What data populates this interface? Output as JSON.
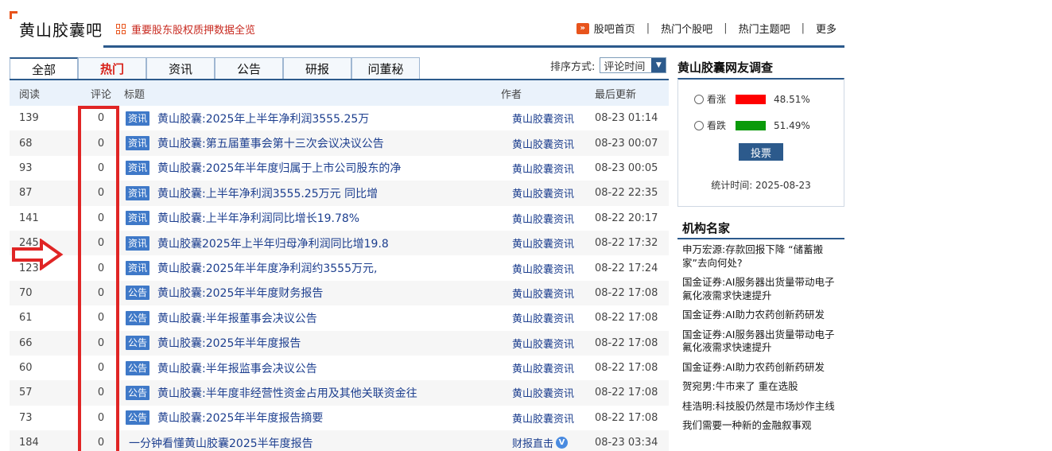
{
  "header": {
    "bar_name": "黄山胶囊吧",
    "pledge_link": "重要股东股权质押数据全览",
    "nav": [
      "股吧首页",
      "热门个股吧",
      "热门主题吧",
      "更多"
    ],
    "nav_sep": "|"
  },
  "tabs": [
    "全部",
    "热门",
    "资讯",
    "公告",
    "研报",
    "问董秘"
  ],
  "sort": {
    "label": "排序方式:",
    "value": "评论时间"
  },
  "list": {
    "columns": [
      "阅读",
      "评论",
      "标题",
      "作者",
      "最后更新"
    ],
    "rows": [
      {
        "read": "139",
        "comments": "0",
        "tag": "资讯",
        "title": "黄山胶囊:2025年上半年净利润3555.25万",
        "author": "黄山胶囊资讯",
        "time": "08-23 01:14"
      },
      {
        "read": "68",
        "comments": "0",
        "tag": "资讯",
        "title": "黄山胶囊:第五届董事会第十三次会议决议公告",
        "author": "黄山胶囊资讯",
        "time": "08-23 00:07"
      },
      {
        "read": "93",
        "comments": "0",
        "tag": "资讯",
        "title": "黄山胶囊:2025年半年度归属于上市公司股东的净",
        "author": "黄山胶囊资讯",
        "time": "08-23 00:05"
      },
      {
        "read": "87",
        "comments": "0",
        "tag": "资讯",
        "title": "黄山胶囊:上半年净利润3555.25万元 同比增",
        "author": "黄山胶囊资讯",
        "time": "08-22 22:35"
      },
      {
        "read": "141",
        "comments": "0",
        "tag": "资讯",
        "title": "黄山胶囊:上半年净利润同比增长19.78%",
        "author": "黄山胶囊资讯",
        "time": "08-22 20:17"
      },
      {
        "read": "245",
        "comments": "0",
        "tag": "资讯",
        "title": "黄山胶囊2025年上半年归母净利润同比增19.8",
        "author": "黄山胶囊资讯",
        "time": "08-22 17:32"
      },
      {
        "read": "123",
        "comments": "0",
        "tag": "资讯",
        "title": "黄山胶囊:2025年半年度净利润约3555万元,",
        "author": "黄山胶囊资讯",
        "time": "08-22 17:24"
      },
      {
        "read": "70",
        "comments": "0",
        "tag": "公告",
        "title": "黄山胶囊:2025年半年度财务报告",
        "author": "黄山胶囊资讯",
        "time": "08-22 17:08"
      },
      {
        "read": "61",
        "comments": "0",
        "tag": "公告",
        "title": "黄山胶囊:半年报董事会决议公告",
        "author": "黄山胶囊资讯",
        "time": "08-22 17:08"
      },
      {
        "read": "66",
        "comments": "0",
        "tag": "公告",
        "title": "黄山胶囊:2025年半年度报告",
        "author": "黄山胶囊资讯",
        "time": "08-22 17:08"
      },
      {
        "read": "60",
        "comments": "0",
        "tag": "公告",
        "title": "黄山胶囊:半年报监事会决议公告",
        "author": "黄山胶囊资讯",
        "time": "08-22 17:08"
      },
      {
        "read": "57",
        "comments": "0",
        "tag": "公告",
        "title": "黄山胶囊:半年度非经营性资金占用及其他关联资金往",
        "author": "黄山胶囊资讯",
        "time": "08-22 17:08"
      },
      {
        "read": "73",
        "comments": "0",
        "tag": "公告",
        "title": "黄山胶囊:2025年半年度报告摘要",
        "author": "黄山胶囊资讯",
        "time": "08-22 17:08"
      },
      {
        "read": "184",
        "comments": "0",
        "tag": "",
        "title": "一分钟看懂黄山胶囊2025半年度报告",
        "author": "财报直击",
        "verified": true,
        "time": "08-23 03:34"
      }
    ]
  },
  "survey": {
    "title": "黄山胶囊网友调查",
    "options": [
      {
        "label": "看涨",
        "percent": "48.51%",
        "color": "#ff0000"
      },
      {
        "label": "看跌",
        "percent": "51.49%",
        "color": "#0a9a0a"
      }
    ],
    "vote_label": "投票",
    "stat_time": "统计时间: 2025-08-23"
  },
  "institutions": {
    "title": "机构名家",
    "items": [
      "申万宏源:存款回报下降 “储蓄搬家”去向何处?",
      "国金证券:AI服务器出货量带动电子氟化液需求快速提升",
      "国金证券:AI助力农药创新药研发",
      "国金证券:AI服务器出货量带动电子氟化液需求快速提升",
      "国金证券:AI助力农药创新药研发",
      "贺宛男:牛市来了 重在选股",
      "桂浩明:科技股仍然是市场炒作主线",
      "我们需要一种新的金融叙事观"
    ]
  },
  "colors": {
    "accent": "#2c5a8c",
    "tag_bg": "#3f79c8",
    "annotation": "#e02525",
    "brand_orange": "#e8541c"
  }
}
